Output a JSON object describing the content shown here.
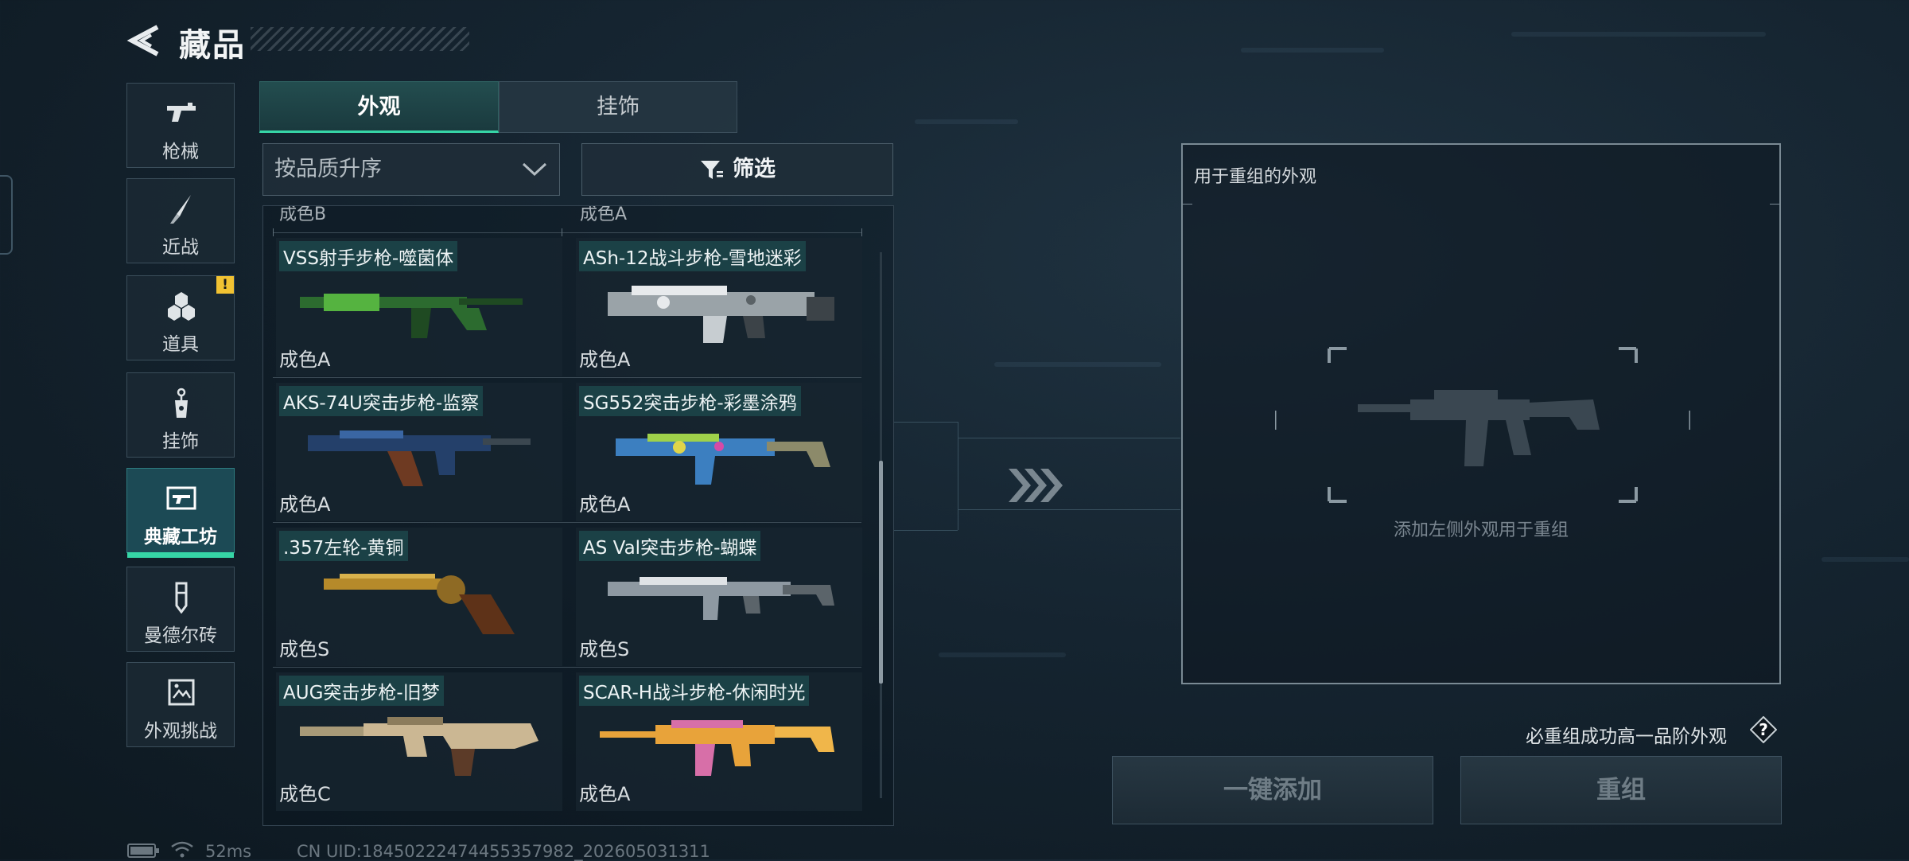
{
  "header": {
    "title": "藏品"
  },
  "categories": [
    {
      "label": "枪械",
      "icon": "gun-icon"
    },
    {
      "label": "近战",
      "icon": "knife-icon"
    },
    {
      "label": "道具",
      "icon": "grenade-icon",
      "badge": "!"
    },
    {
      "label": "挂饰",
      "icon": "charm-icon"
    },
    {
      "label": "典藏工坊",
      "icon": "workshop-icon",
      "active": true
    },
    {
      "label": "曼德尔砖",
      "icon": "brick-icon"
    },
    {
      "label": "外观挑战",
      "icon": "challenge-icon"
    }
  ],
  "tabs": [
    {
      "label": "外观",
      "active": true
    },
    {
      "label": "挂饰",
      "active": false
    }
  ],
  "sort": {
    "label": "按品质升序"
  },
  "filter": {
    "label": "筛选"
  },
  "cut_row": [
    "成色B",
    "成色A"
  ],
  "skins": [
    {
      "name": "VSS射手步枪-噬菌体",
      "grade": "成色A",
      "colors": [
        "#2c6b2f",
        "#55b340"
      ]
    },
    {
      "name": "ASh-12战斗步枪-雪地迷彩",
      "grade": "成色A",
      "colors": [
        "#9aa3a8",
        "#e7eaec"
      ]
    },
    {
      "name": "AKS-74U突击步枪-监察",
      "grade": "成色A",
      "colors": [
        "#24406a",
        "#6e3a22"
      ]
    },
    {
      "name": "SG552突击步枪-彩墨涂鸦",
      "grade": "成色A",
      "colors": [
        "#3c7fc0",
        "#9fd14a"
      ]
    },
    {
      "name": ".357左轮-黄铜",
      "grade": "成色S",
      "colors": [
        "#b68a2a",
        "#5e3218"
      ]
    },
    {
      "name": "AS Val突击步枪-蝴蝶",
      "grade": "成色S",
      "colors": [
        "#8e99a2",
        "#dfe3e6"
      ]
    },
    {
      "name": "AUG突击步枪-旧梦",
      "grade": "成色C",
      "colors": [
        "#cbb793",
        "#5c3b28"
      ]
    },
    {
      "name": "SCAR-H战斗步枪-休闲时光",
      "grade": "成色A",
      "colors": [
        "#e8a33a",
        "#d76fa8"
      ]
    }
  ],
  "target": {
    "title": "用于重组的外观",
    "hint": "添加左侧外观用于重组"
  },
  "note": "必重组成功高一品阶外观",
  "buttons": {
    "add_all": "一键添加",
    "reassemble": "重组"
  },
  "status": {
    "ping": "52ms",
    "uid": "CN UID:18450222474455357982_202605031311"
  },
  "colors": {
    "accent": "#36d5a6",
    "tab_active": "#1c4a55",
    "warning": "#f1c232"
  }
}
